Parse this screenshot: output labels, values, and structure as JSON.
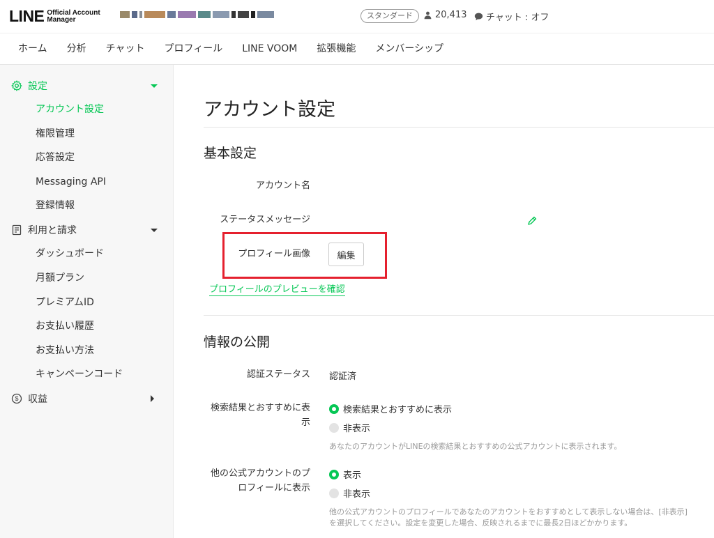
{
  "header": {
    "logo_main": "LINE",
    "logo_sub_1": "Official Account",
    "logo_sub_2": "Manager",
    "plan_badge": "スタンダード",
    "follower_count": "20,413",
    "chat_status": "チャット : オフ"
  },
  "nav": {
    "items": [
      "ホーム",
      "分析",
      "チャット",
      "プロフィール",
      "LINE VOOM",
      "拡張機能",
      "メンバーシップ"
    ]
  },
  "sidebar": {
    "settings": {
      "label": "設定",
      "items": [
        "アカウント設定",
        "権限管理",
        "応答設定",
        "Messaging API",
        "登録情報"
      ]
    },
    "billing": {
      "label": "利用と請求",
      "items": [
        "ダッシュボード",
        "月額プラン",
        "プレミアムID",
        "お支払い履歴",
        "お支払い方法",
        "キャンペーンコード"
      ]
    },
    "revenue": {
      "label": "収益"
    }
  },
  "main": {
    "page_title": "アカウント設定",
    "basic": {
      "title": "基本設定",
      "account_name_label": "アカウント名",
      "status_message_label": "ステータスメッセージ",
      "profile_image_label": "プロフィール画像",
      "edit_button": "編集",
      "preview_link": "プロフィールのプレビューを確認"
    },
    "disclosure": {
      "title": "情報の公開",
      "verification_label": "認証ステータス",
      "verification_value": "認証済",
      "search_label_1": "検索結果とおすすめに表",
      "search_label_2": "示",
      "search_option_show": "検索結果とおすすめに表示",
      "search_option_hide": "非表示",
      "search_help": "あなたのアカウントがLINEの検索結果とおすすめの公式アカウントに表示されます。",
      "other_label_1": "他の公式アカウントのプ",
      "other_label_2": "ロフィールに表示",
      "other_option_show": "表示",
      "other_option_hide": "非表示",
      "other_help_1": "他の公式アカウントのプロフィールであなたのアカウントをおすすめとして表示しない場合は、[非表示]",
      "other_help_2": "を選択してください。設定を変更した場合、反映されるまでに最長2日ほどかかります。"
    }
  },
  "colors": {
    "accent": "#06c755",
    "highlight": "#e5202e"
  }
}
